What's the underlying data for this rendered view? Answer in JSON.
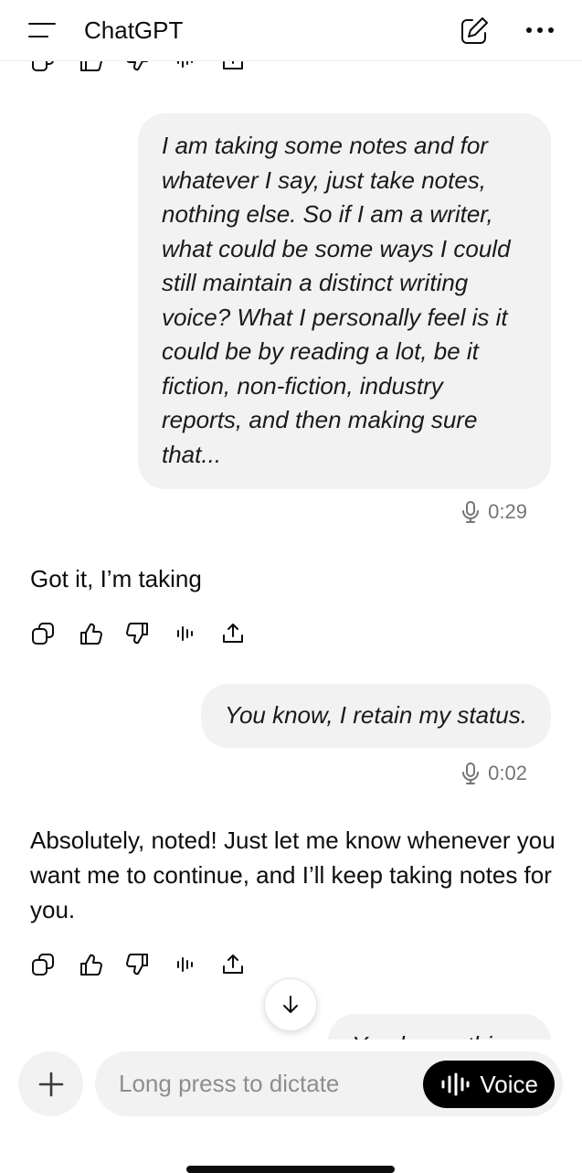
{
  "header": {
    "title": "ChatGPT"
  },
  "messages": [
    {
      "role": "user",
      "text": "I am taking some notes and for whatever I say, just take notes, nothing else. So if I am a writer, what could be some ways I could still maintain a distinct writing voice? What I personally feel is it could be by reading a lot, be it fiction, non-fiction, industry reports, and then making sure that...",
      "duration": "0:29"
    },
    {
      "role": "assistant",
      "text": "Got it, I’m taking"
    },
    {
      "role": "user",
      "text": "You know, I retain my status.",
      "duration": "0:02"
    },
    {
      "role": "assistant",
      "text": "Absolutely, noted! Just let me know whenever you want me to continue, and I’ll keep taking notes for you."
    },
    {
      "role": "user",
      "text": "You know, thi..."
    }
  ],
  "actions": [
    "copy-icon",
    "thumbs-up-icon",
    "thumbs-down-icon",
    "read-aloud-icon",
    "share-icon"
  ],
  "composer": {
    "placeholder": "Long press to dictate",
    "voice_label": "Voice"
  },
  "colors": {
    "bubble_bg": "#f2f2f2",
    "muted_text": "#757575",
    "voice_button_bg": "#000000"
  }
}
